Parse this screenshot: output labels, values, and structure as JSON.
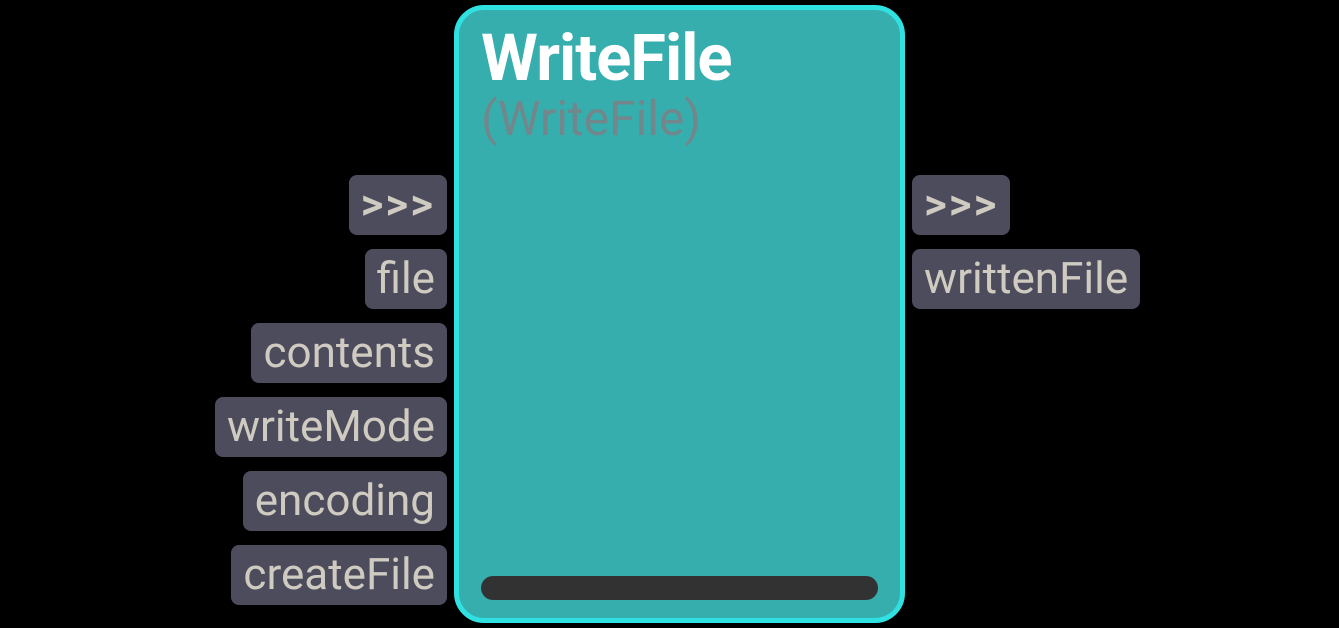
{
  "node": {
    "title": "WriteFile",
    "type": "(WriteFile)"
  },
  "inputs": {
    "exec": ">>>",
    "items": [
      "file",
      "contents",
      "writeMode",
      "encoding",
      "createFile"
    ]
  },
  "outputs": {
    "exec": ">>>",
    "items": [
      "writtenFile"
    ]
  },
  "colors": {
    "node_bg": "#37aeae",
    "node_border": "#2fe1e1",
    "port_bg": "#4d4c5d",
    "port_text": "#cfcbc1"
  }
}
